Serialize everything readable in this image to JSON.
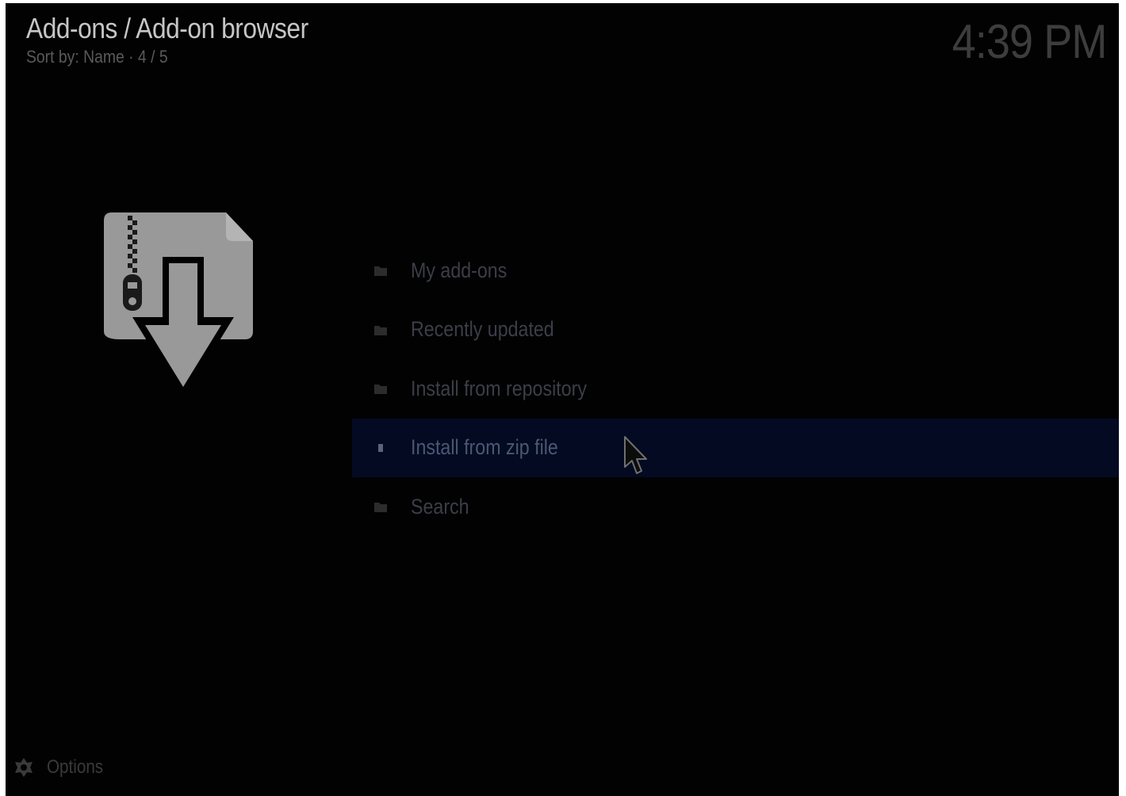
{
  "header": {
    "breadcrumb": "Add-ons / Add-on browser",
    "sort_status": "Sort by: Name · 4 / 5"
  },
  "clock": "4:39 PM",
  "preview": {
    "icon": "zip-file-download-icon"
  },
  "menu": {
    "items": [
      {
        "label": "My add-ons",
        "icon": "folder-icon",
        "selected": false
      },
      {
        "label": "Recently updated",
        "icon": "folder-icon",
        "selected": false
      },
      {
        "label": "Install from repository",
        "icon": "folder-icon",
        "selected": false
      },
      {
        "label": "Install from zip file",
        "icon": "file-icon",
        "selected": true
      },
      {
        "label": "Search",
        "icon": "folder-icon",
        "selected": false
      }
    ]
  },
  "footer": {
    "options_label": "Options",
    "options_icon": "options-icon"
  },
  "colors": {
    "background": "#020203",
    "selection": "#030a22",
    "text_primary": "#c6c6c6",
    "text_dim": "#3c3e48"
  }
}
